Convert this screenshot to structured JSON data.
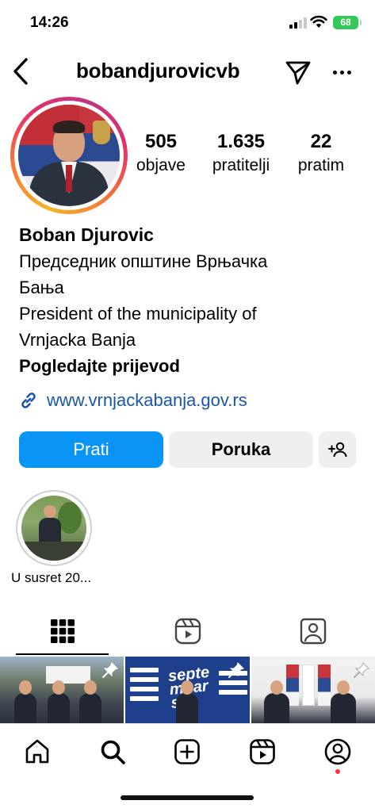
{
  "status_bar": {
    "time": "14:26",
    "battery": "68"
  },
  "header": {
    "username": "bobandjurovicvb"
  },
  "stats": {
    "posts": {
      "value": "505",
      "label": "objave"
    },
    "followers": {
      "value": "1.635",
      "label": "pratitelji"
    },
    "following": {
      "value": "22",
      "label": "pratim"
    }
  },
  "bio": {
    "name": "Boban Djurovic",
    "lines": [
      "Председник општине Врњачка",
      "Бања",
      "President of the municipality of",
      "Vrnjacka Banja"
    ],
    "translate_label": "Pogledajte prijevod",
    "link": "www.vrnjackabanja.gov.rs"
  },
  "buttons": {
    "follow": "Prati",
    "message": "Poruka"
  },
  "highlights": [
    {
      "label": "U susret 20..."
    }
  ],
  "posts_grid": {
    "post2_text": "septembarski"
  },
  "colors": {
    "accent": "#0a95f6",
    "link": "#1a56a9",
    "notification": "#ff3040"
  }
}
